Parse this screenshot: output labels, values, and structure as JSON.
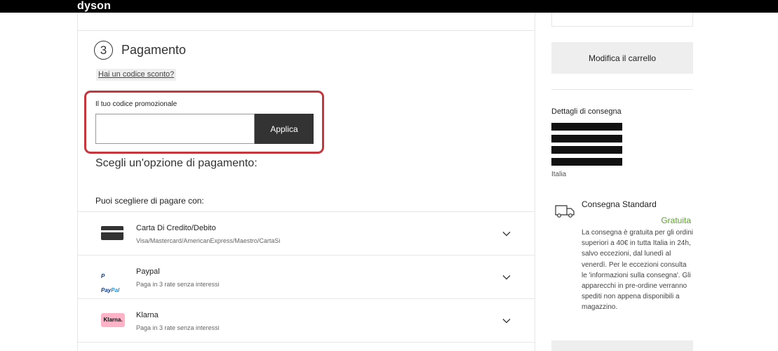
{
  "header": {
    "logo": "dyson"
  },
  "payment": {
    "step_number": "3",
    "title": "Pagamento",
    "discount_link": "Hai un codice sconto?",
    "promo": {
      "label": "Il tuo codice promozionale",
      "value": "",
      "placeholder": "",
      "apply_label": "Applica"
    },
    "choose_heading": "Scegli un'opzione di pagamento:",
    "pay_with": "Puoi scegliere di pagare con:",
    "options": [
      {
        "name": "Carta Di Credito/Debito",
        "desc": "Visa/Mastercard/AmericanExpress/Maestro/CartaSi",
        "icon": "credit-card-icon"
      },
      {
        "name": "Paypal",
        "desc": "Paga in 3 rate senza interessi",
        "icon": "paypal-logo",
        "logo_text_a": "P",
        "logo_text_b": "Pay",
        "logo_text_c": "Pal"
      },
      {
        "name": "Klarna",
        "desc": "Paga in 3 rate senza interessi",
        "icon": "klarna-logo",
        "logo_text": "Klarna."
      }
    ]
  },
  "sidebar": {
    "edit_cart": "Modifica il carrello",
    "delivery_title": "Dettagli di consegna",
    "delivery_country": "Italia",
    "shipping": {
      "title": "Consegna Standard",
      "price": "Gratuita",
      "description": "La consegna è gratuita per gli ordini superiori a 40€ in tutta Italia in 24h, salvo eccezioni, dal lunedì al venerdì. Per le eccezioni consulta le 'informazioni sulla consegna'. Gli apparecchi in pre-ordine verranno spediti non appena disponibili a magazzino."
    }
  },
  "colors": {
    "highlight_border": "#c8363d",
    "button_dark": "#333333",
    "free_green": "#5c9e2e",
    "klarna_pink": "#ffb3c7"
  }
}
